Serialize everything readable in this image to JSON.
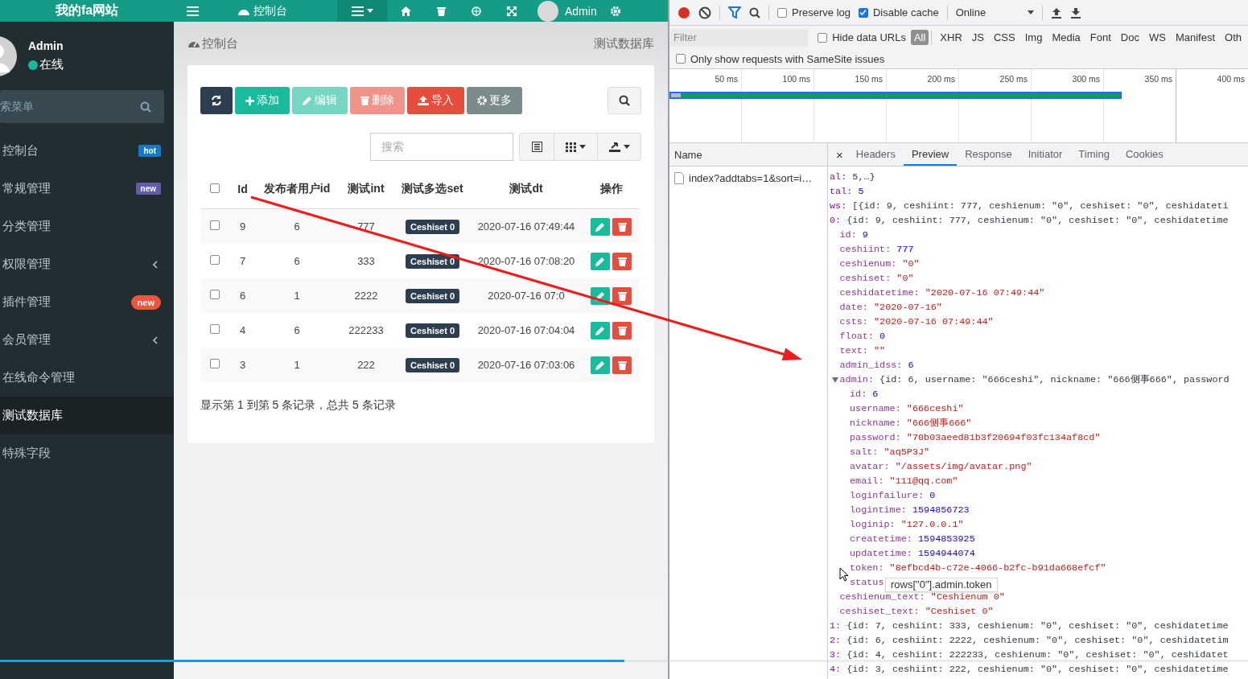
{
  "header": {
    "logo": "我的fa网站",
    "tab": "控制台",
    "user": "Admin"
  },
  "sidebar": {
    "user": {
      "name": "Admin",
      "status": "在线"
    },
    "search": {
      "placeholder": "索菜单"
    },
    "items": [
      {
        "label": "控制台",
        "selected": false,
        "expandable": false,
        "badge": {
          "text": "hot",
          "kind": "label",
          "color": "#1479c9"
        }
      },
      {
        "label": "常规管理",
        "selected": false,
        "expandable": false,
        "badge": {
          "text": "new",
          "kind": "label",
          "color": "#605ca8"
        }
      },
      {
        "label": "分类管理",
        "selected": false,
        "expandable": false
      },
      {
        "label": "权限管理",
        "selected": false,
        "expandable": true
      },
      {
        "label": "插件管理",
        "selected": false,
        "expandable": false,
        "badge": {
          "text": "new",
          "kind": "pill",
          "color": "#f0543c"
        }
      },
      {
        "label": "会员管理",
        "selected": false,
        "expandable": true
      },
      {
        "label": "在线命令管理",
        "selected": false,
        "expandable": false
      },
      {
        "label": "测试数据库",
        "selected": true,
        "expandable": false
      },
      {
        "label": "特殊字段",
        "selected": false,
        "expandable": false
      }
    ]
  },
  "breadcrumb": {
    "title": "控制台",
    "current": "测试数据库"
  },
  "toolbar": {
    "buttons": [
      {
        "kind": "refresh",
        "disabled": false
      },
      {
        "kind": "add",
        "label": "添加",
        "disabled": false
      },
      {
        "kind": "edit",
        "label": "编辑",
        "disabled": true
      },
      {
        "kind": "delete",
        "label": "删除",
        "disabled": true
      },
      {
        "kind": "import",
        "label": "导入",
        "disabled": false
      },
      {
        "kind": "more",
        "label": "更多",
        "disabled": false
      }
    ],
    "search": {
      "placeholder": "搜索"
    }
  },
  "table": {
    "columns": [
      "Id",
      "发布者用户id",
      "测试int",
      "测试多选set",
      "测试dt",
      "操作"
    ],
    "all_checked": false,
    "rows": [
      {
        "checked": false,
        "cells": [
          "9",
          "6",
          "777",
          "Ceshiset 0",
          "2020-07-16 07:49:44"
        ]
      },
      {
        "checked": false,
        "cells": [
          "7",
          "6",
          "333",
          "Ceshiset 0",
          "2020-07-16 07:08:20"
        ]
      },
      {
        "checked": false,
        "cells": [
          "6",
          "1",
          "2222",
          "Ceshiset 0",
          "2020-07-16 07:0"
        ]
      },
      {
        "checked": false,
        "cells": [
          "4",
          "6",
          "222233",
          "Ceshiset 0",
          "2020-07-16 07:04:04"
        ]
      },
      {
        "checked": false,
        "cells": [
          "3",
          "1",
          "222",
          "Ceshiset 0",
          "2020-07-16 07:03:06"
        ]
      }
    ]
  },
  "pagination": {
    "summary": "显示第 1 到第 5 条记录，总共 5 条记录"
  },
  "video_progress": {
    "level": 0.5
  },
  "devtools": {
    "toolbar": {
      "recording": true,
      "preserve_log": {
        "label": "Preserve log",
        "checked": false
      },
      "disable_cache": {
        "label": "Disable cache",
        "checked": true
      },
      "throttling": "Online"
    },
    "filter": {
      "placeholder": "Filter",
      "hide_data_urls": {
        "label": "Hide data URLs",
        "checked": false
      },
      "types": [
        {
          "label": "All",
          "selected": true
        },
        {
          "label": "XHR",
          "selected": false
        },
        {
          "label": "JS",
          "selected": false
        },
        {
          "label": "CSS",
          "selected": false
        },
        {
          "label": "Img",
          "selected": false
        },
        {
          "label": "Media",
          "selected": false
        },
        {
          "label": "Font",
          "selected": false
        },
        {
          "label": "Doc",
          "selected": false
        },
        {
          "label": "WS",
          "selected": false
        },
        {
          "label": "Manifest",
          "selected": false
        },
        {
          "label": "Oth",
          "selected": false
        }
      ],
      "samesite": {
        "label": "Only show requests with SameSite issues",
        "checked": false
      }
    },
    "overview": {
      "ticks": [
        "50 ms",
        "100 ms",
        "150 ms",
        "200 ms",
        "250 ms",
        "300 ms",
        "350 ms",
        "400 ms"
      ]
    },
    "requests": {
      "column": "Name",
      "rows": [
        {
          "name": "index?addtabs=1&sort=i…"
        }
      ]
    },
    "detail": {
      "close": "×",
      "tabs": [
        {
          "label": "Headers",
          "selected": false
        },
        {
          "label": "Preview",
          "selected": true
        },
        {
          "label": "Response",
          "selected": false
        },
        {
          "label": "Initiator",
          "selected": false
        },
        {
          "label": "Timing",
          "selected": false
        },
        {
          "label": "Cookies",
          "selected": false
        }
      ]
    },
    "preview": {
      "lines": [
        {
          "key": "al:",
          "value": "5,…}",
          "kind": "summary"
        },
        {
          "key": "tal:",
          "value": "5",
          "kind": "number"
        },
        {
          "key": "ws:",
          "value": "[{id: 9, ceshiint: 777, ceshienum: \"0\", ceshiset: \"0\", ceshidateti",
          "kind": "summary"
        },
        {
          "key": "0:",
          "value": "{id: 9, ceshiint: 777, ceshienum: \"0\", ceshiset: \"0\", ceshidatetime",
          "kind": "summary",
          "children": [
            {
              "key": "id:",
              "value": "9",
              "kind": "number"
            },
            {
              "key": "ceshiint:",
              "value": "777",
              "kind": "number"
            },
            {
              "key": "ceshienum:",
              "value": "\"0\"",
              "kind": "string"
            },
            {
              "key": "ceshiset:",
              "value": "\"0\"",
              "kind": "string"
            },
            {
              "key": "ceshidatetime:",
              "value": "\"2020-07-16 07:49:44\"",
              "kind": "string"
            },
            {
              "key": "date:",
              "value": "\"2020-07-16\"",
              "kind": "string"
            },
            {
              "key": "csts:",
              "value": "\"2020-07-16 07:49:44\"",
              "kind": "string"
            },
            {
              "key": "float:",
              "value": "0",
              "kind": "number"
            },
            {
              "key": "text:",
              "value": "\"\"",
              "kind": "string"
            },
            {
              "key": "admin_idss:",
              "value": "6",
              "kind": "number"
            },
            {
              "key": "admin:",
              "value": "{id: 6, username: \"666ceshi\", nickname: \"666侧事666\", password",
              "kind": "summary",
              "expanded": true,
              "children": [
                {
                  "key": "id:",
                  "value": "6",
                  "kind": "number"
                },
                {
                  "key": "username:",
                  "value": "\"666ceshi\"",
                  "kind": "string"
                },
                {
                  "key": "nickname:",
                  "value": "\"666侧事666\"",
                  "kind": "string"
                },
                {
                  "key": "password:",
                  "value": "\"70b03aeed81b3f20694f03fc134af8cd\"",
                  "kind": "string"
                },
                {
                  "key": "salt:",
                  "value": "\"aq5P3J\"",
                  "kind": "string"
                },
                {
                  "key": "avatar:",
                  "value": "\"/assets/img/avatar.png\"",
                  "kind": "string"
                },
                {
                  "key": "email:",
                  "value": "\"111@qq.com\"",
                  "kind": "string"
                },
                {
                  "key": "loginfailure:",
                  "value": "0",
                  "kind": "number"
                },
                {
                  "key": "logintime:",
                  "value": "1594856723",
                  "kind": "number"
                },
                {
                  "key": "loginip:",
                  "value": "\"127.0.0.1\"",
                  "kind": "string"
                },
                {
                  "key": "createtime:",
                  "value": "1594853925",
                  "kind": "number"
                },
                {
                  "key": "updatetime:",
                  "value": "1594944074",
                  "kind": "number"
                },
                {
                  "key": "token:",
                  "value": "\"8efbcd4b-c72e-4066-b2fc-b91da668efcf\"",
                  "kind": "string"
                },
                {
                  "key": "status"
                }
              ]
            },
            {
              "key": "ceshienum_text:",
              "value": "\"Ceshienum 0\"",
              "kind": "string"
            },
            {
              "key": "ceshiset_text:",
              "value": "\"Ceshiset 0\"",
              "kind": "string"
            }
          ]
        },
        {
          "key": "1:",
          "value": "{id: 7, ceshiint: 333, ceshienum: \"0\", ceshiset: \"0\", ceshidatetime",
          "kind": "summary"
        },
        {
          "key": "2:",
          "value": "{id: 6, ceshiint: 2222, ceshienum: \"0\", ceshiset: \"0\", ceshidatetim",
          "kind": "summary"
        },
        {
          "key": "3:",
          "value": "{id: 4, ceshiint: 222233, ceshienum: \"0\", ceshiset: \"0\", ceshidatet",
          "kind": "summary"
        },
        {
          "key": "4:",
          "value": "{id: 3, ceshiint: 222, ceshienum: \"0\", ceshiset: \"0\", ceshidatetime",
          "kind": "summary"
        }
      ]
    },
    "tooltip": "rows[\"0\"].admin.token"
  }
}
